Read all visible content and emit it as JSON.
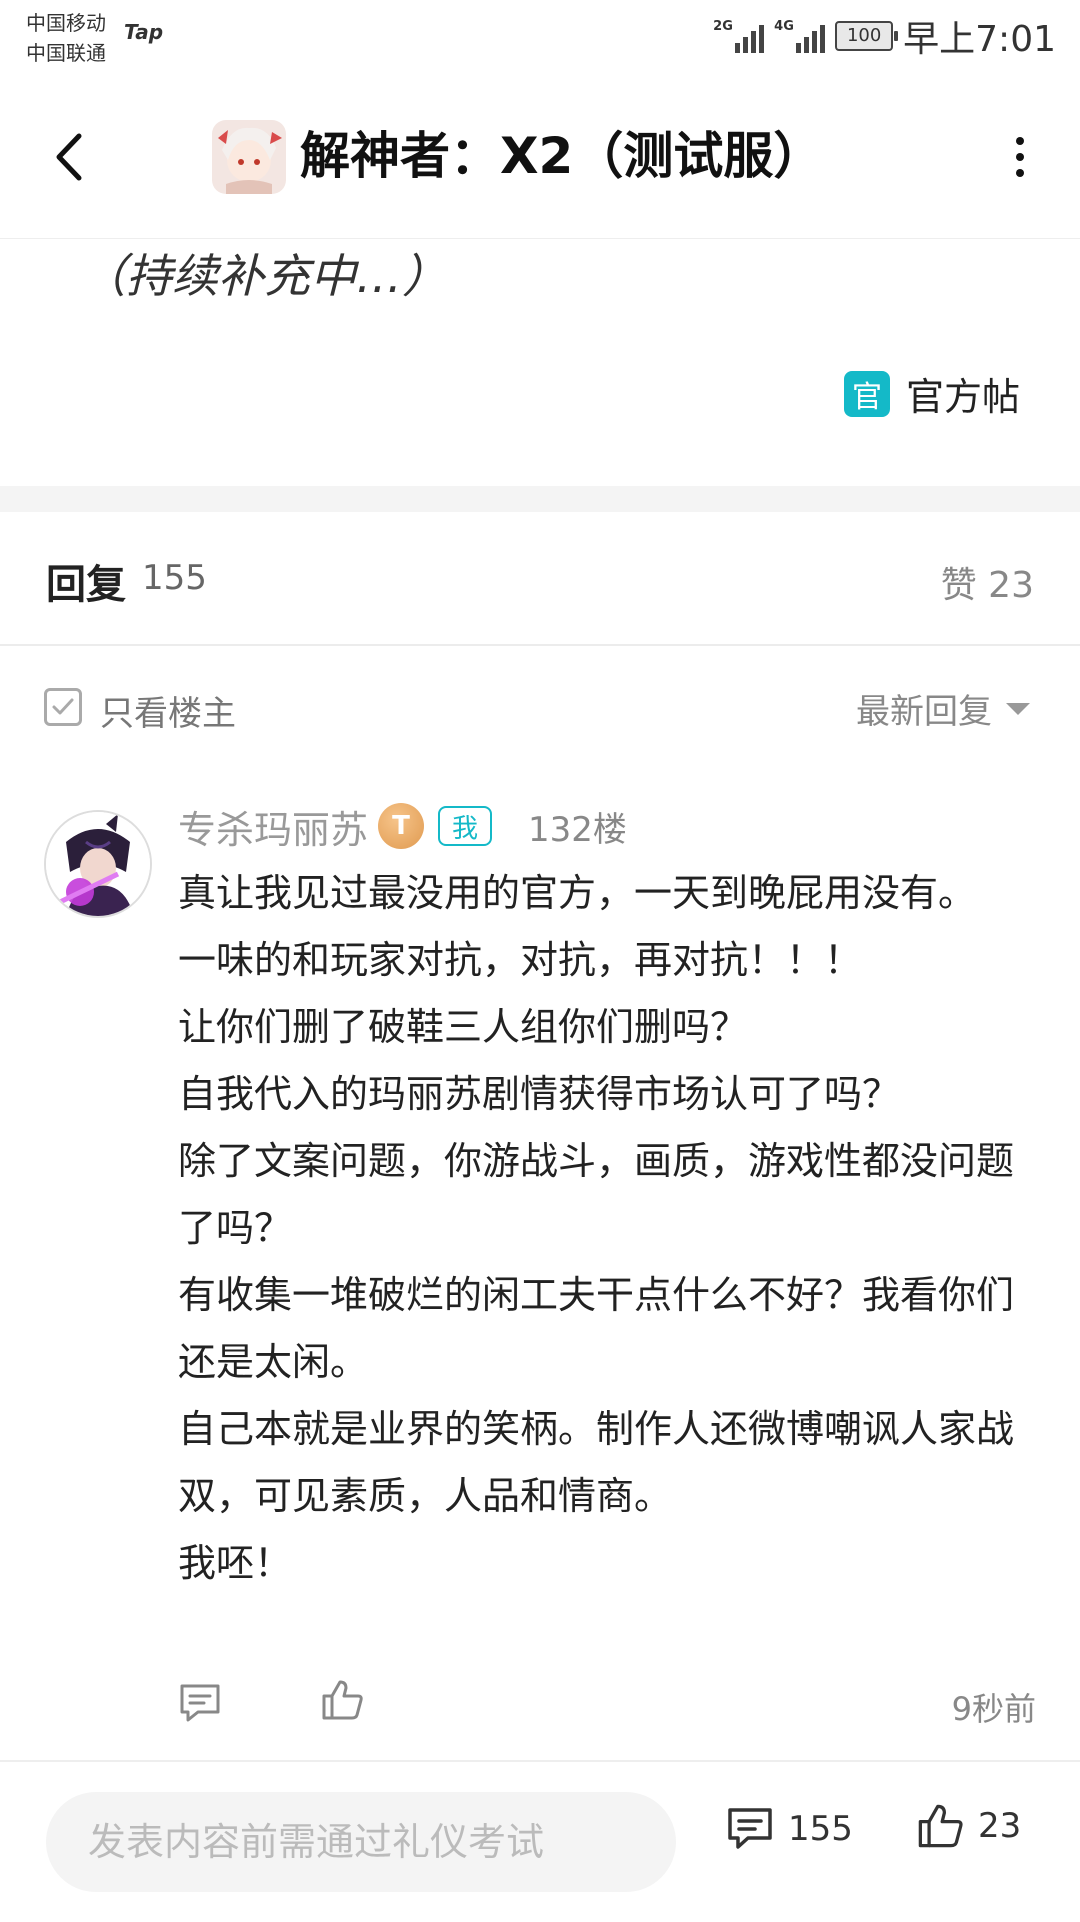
{
  "status_bar": {
    "carrier_1": "中国移动",
    "carrier_2": "中国联通",
    "app_mark": "Tap",
    "network_1": "2G",
    "network_2": "4G",
    "battery": "100",
    "time": "早上7:01"
  },
  "header": {
    "title": "解神者：X2（测试服）",
    "icons": [
      "back-arrow-icon",
      "more-vertical-icon"
    ]
  },
  "post": {
    "continued_text": "（持续补充中…）",
    "official_badge": "官",
    "official_label": "官方帖"
  },
  "replies_header": {
    "title": "回复",
    "count": "155",
    "likes": "赞 23"
  },
  "filter": {
    "only_author_label": "只看楼主",
    "sort_label": "最新回复"
  },
  "comment": {
    "username": "专杀玛丽苏",
    "level_badge": "T",
    "me_badge": "我",
    "floor": "132楼",
    "lines": [
      "真让我见过最没用的官方，一天到晚屁用没有。",
      "一味的和玩家对抗，对抗，再对抗！！！",
      "让你们删了破鞋三人组你们删吗？",
      "自我代入的玛丽苏剧情获得市场认可了吗？",
      "除了文案问题，你游战斗，画质，游戏性都没问题了吗？",
      "有收集一堆破烂的闲工夫干点什么不好？我看你们还是太闲。",
      "自己本就是业界的笑柄。制作人还微博嘲讽人家战双，可见素质，人品和情商。",
      "我呸！"
    ],
    "time": "9秒前"
  },
  "bottom_bar": {
    "input_placeholder": "发表内容前需通过礼仪考试",
    "comment_count": "155",
    "like_count": "23"
  },
  "colors": {
    "accent": "#14b9c8",
    "level_badge": "#e6a55e",
    "muted_text": "#888888"
  }
}
